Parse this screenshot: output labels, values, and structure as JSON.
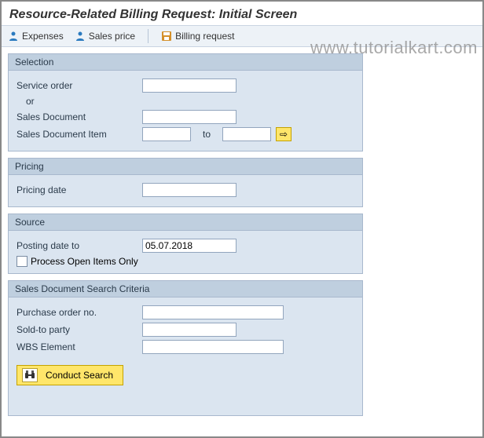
{
  "title": "Resource-Related Billing Request: Initial Screen",
  "toolbar": {
    "expenses_label": "Expenses",
    "sales_price_label": "Sales price",
    "billing_request_label": "Billing request"
  },
  "watermark": "www.tutorialkart.com",
  "selection": {
    "header": "Selection",
    "service_order_label": "Service order",
    "service_order_value": "",
    "or_label": "or",
    "sales_document_label": "Sales Document",
    "sales_document_value": "",
    "sales_document_item_label": "Sales Document Item",
    "sales_document_item_value": "",
    "to_label": "to",
    "sales_document_item_to_value": ""
  },
  "pricing": {
    "header": "Pricing",
    "pricing_date_label": "Pricing date",
    "pricing_date_value": ""
  },
  "source": {
    "header": "Source",
    "posting_date_to_label": "Posting date to",
    "posting_date_to_value": "05.07.2018",
    "process_open_items_label": "Process Open Items Only",
    "process_open_items_checked": false
  },
  "criteria": {
    "header": "Sales Document Search Criteria",
    "purchase_order_label": "Purchase order no.",
    "purchase_order_value": "",
    "sold_to_party_label": "Sold-to party",
    "sold_to_party_value": "",
    "wbs_element_label": "WBS Element",
    "wbs_element_value": "",
    "conduct_search_label": "Conduct Search"
  }
}
